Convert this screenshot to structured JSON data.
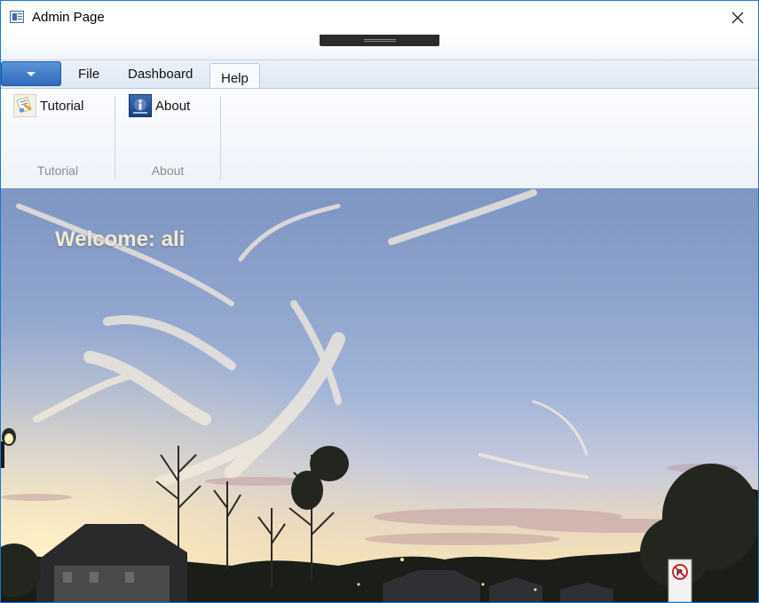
{
  "window": {
    "title": "Admin Page",
    "close_icon": "close-icon",
    "app_icon": "window-app-icon"
  },
  "ribbon": {
    "application_menu_icon": "caret-down-icon",
    "tabs": [
      {
        "label": "File",
        "selected": false
      },
      {
        "label": "Dashboard",
        "selected": false
      },
      {
        "label": "Help",
        "selected": true
      }
    ],
    "groups": [
      {
        "label": "Tutorial",
        "button": {
          "label": "Tutorial",
          "icon": "tutorial-icon"
        }
      },
      {
        "label": "About",
        "button": {
          "label": "About",
          "icon": "info-icon"
        }
      }
    ]
  },
  "main": {
    "welcome_text": "Welcome: ali",
    "background": "sunset-sky-photo"
  },
  "colors": {
    "window_border": "#1979ca",
    "app_menu_button": "#2f6cbd",
    "welcome_text": "#f3ead2"
  }
}
